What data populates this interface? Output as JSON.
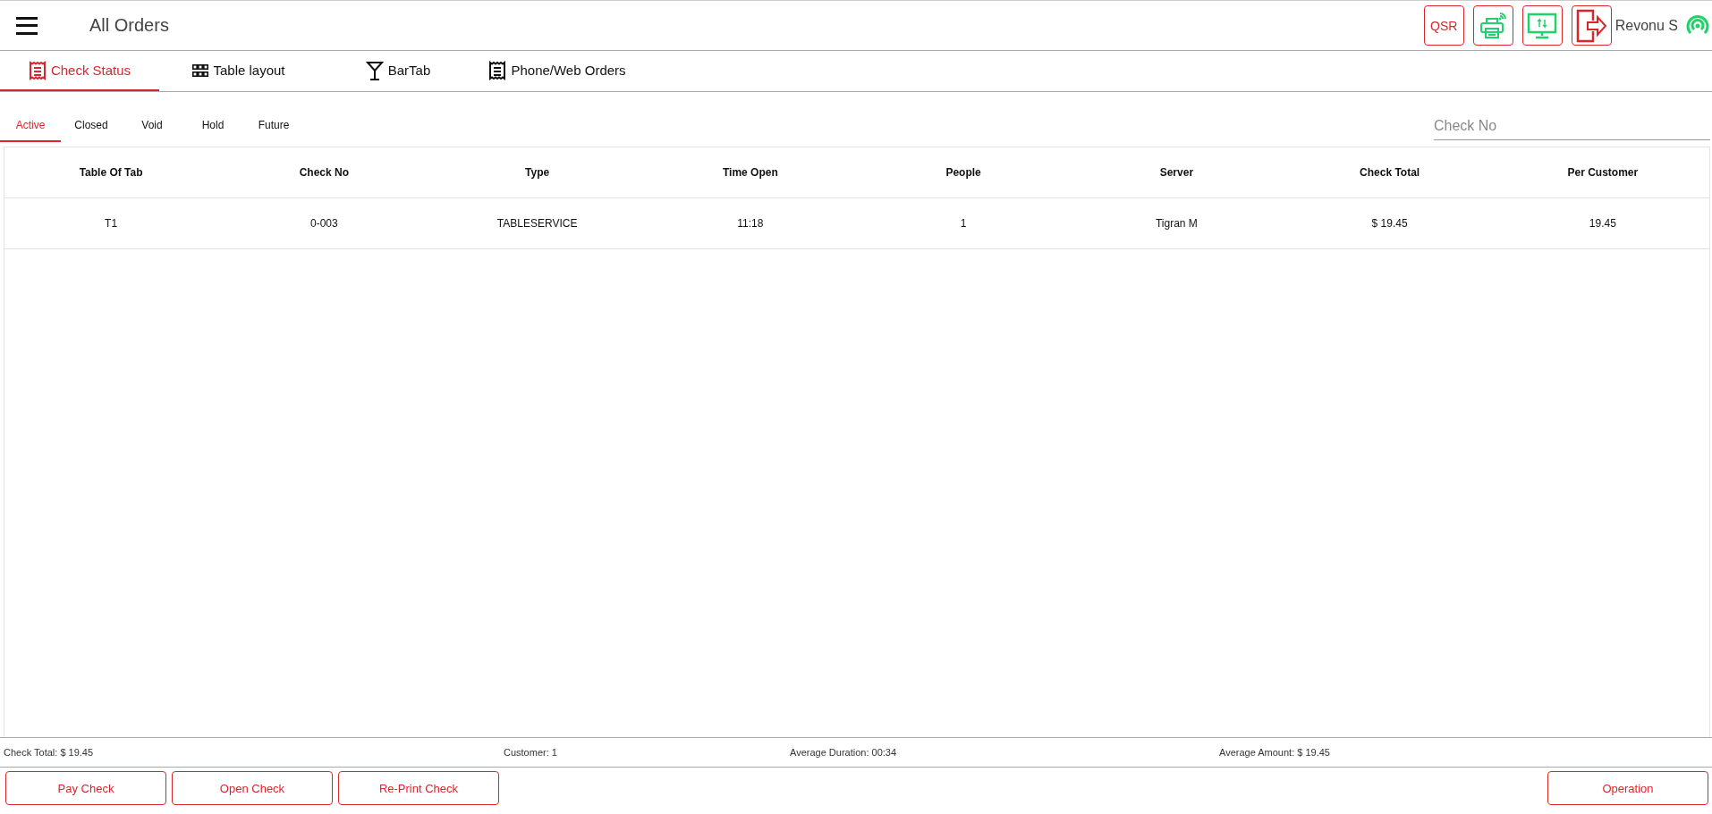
{
  "header": {
    "title": "All Orders",
    "qsr_label": "QSR",
    "user": "Revonu S"
  },
  "tabs": [
    {
      "label": "Check Status",
      "selected": true
    },
    {
      "label": "Table layout",
      "selected": false
    },
    {
      "label": "BarTab",
      "selected": false
    },
    {
      "label": "Phone/Web Orders",
      "selected": false
    }
  ],
  "status_tabs": [
    {
      "label": "Active",
      "selected": true
    },
    {
      "label": "Closed",
      "selected": false
    },
    {
      "label": "Void",
      "selected": false
    },
    {
      "label": "Hold",
      "selected": false
    },
    {
      "label": "Future",
      "selected": false
    }
  ],
  "search": {
    "placeholder": "Check No"
  },
  "table": {
    "columns": [
      "Table Of Tab",
      "Check No",
      "Type",
      "Time Open",
      "People",
      "Server",
      "Check Total",
      "Per Customer"
    ],
    "rows": [
      [
        "T1",
        "0-003",
        "TABLESERVICE",
        "11:18",
        "1",
        "Tigran M",
        "$ 19.45",
        "19.45"
      ]
    ]
  },
  "summary": [
    "Check Total: $ 19.45",
    "Customer: 1",
    "Average Duration: 00:34",
    "Average Amount: $ 19.45"
  ],
  "actions": {
    "left": [
      "Pay Check",
      "Open Check",
      "Re-Print Check"
    ],
    "right": [
      "Operation"
    ]
  }
}
